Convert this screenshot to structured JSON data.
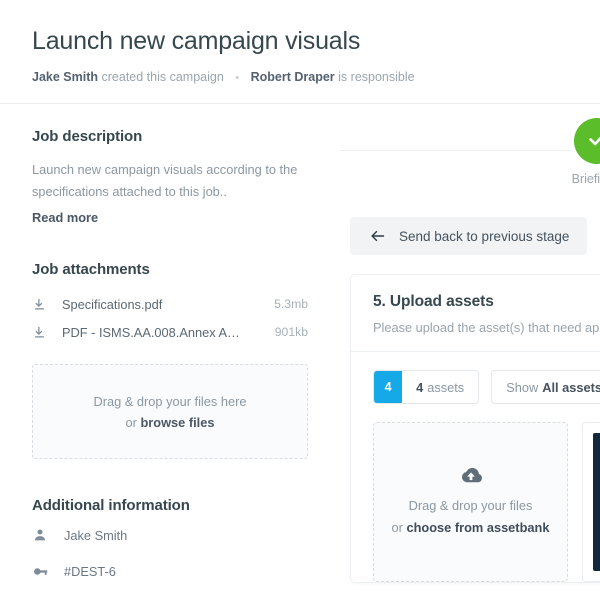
{
  "header": {
    "title": "Launch new campaign visuals",
    "creator": "Jake Smith",
    "created_text": "created this campaign",
    "separator": "•",
    "responsible": "Robert Draper",
    "responsible_text": "is responsible"
  },
  "left": {
    "job_description": {
      "title": "Job description",
      "text": "Launch new campaign visuals according to the specifications attached to this job..",
      "read_more": "Read more"
    },
    "job_attachments": {
      "title": "Job attachments",
      "items": [
        {
          "icon": "download-icon",
          "name": "Specifications.pdf",
          "size": "5.3mb"
        },
        {
          "icon": "download-icon",
          "name": "PDF - ISMS.AA.008.Annex A…",
          "size": "901kb"
        }
      ]
    },
    "dropzone": {
      "line1": "Drag & drop your files here",
      "or": "or ",
      "action": "browse files"
    },
    "additional_information": {
      "title": "Additional information",
      "items": [
        {
          "icon": "person-icon",
          "value": "Jake Smith"
        },
        {
          "icon": "key-icon",
          "value": "#DEST-6"
        }
      ]
    }
  },
  "right": {
    "stage": {
      "badge_icon": "check-icon",
      "badge_color": "#5bbd2a",
      "label": "Briefing"
    },
    "send_back_button": {
      "icon": "arrow-left-icon",
      "label": "Send back to previous stage"
    },
    "upload_card": {
      "title": "5. Upload assets",
      "subtitle": "Please upload the asset(s) that need ap",
      "toolbar": {
        "count": "4",
        "count_label_strong": "4",
        "count_label_rest": "assets",
        "show_label": "Show",
        "show_label_strong": "All assets",
        "accent_color": "#16a9e8"
      },
      "tiles": {
        "dropzone": {
          "icon": "cloud-upload-icon",
          "line1": "Drag & drop your files",
          "or": "or ",
          "action": "choose from assetbank"
        },
        "asset_thumb_color": "#12293b"
      }
    }
  }
}
